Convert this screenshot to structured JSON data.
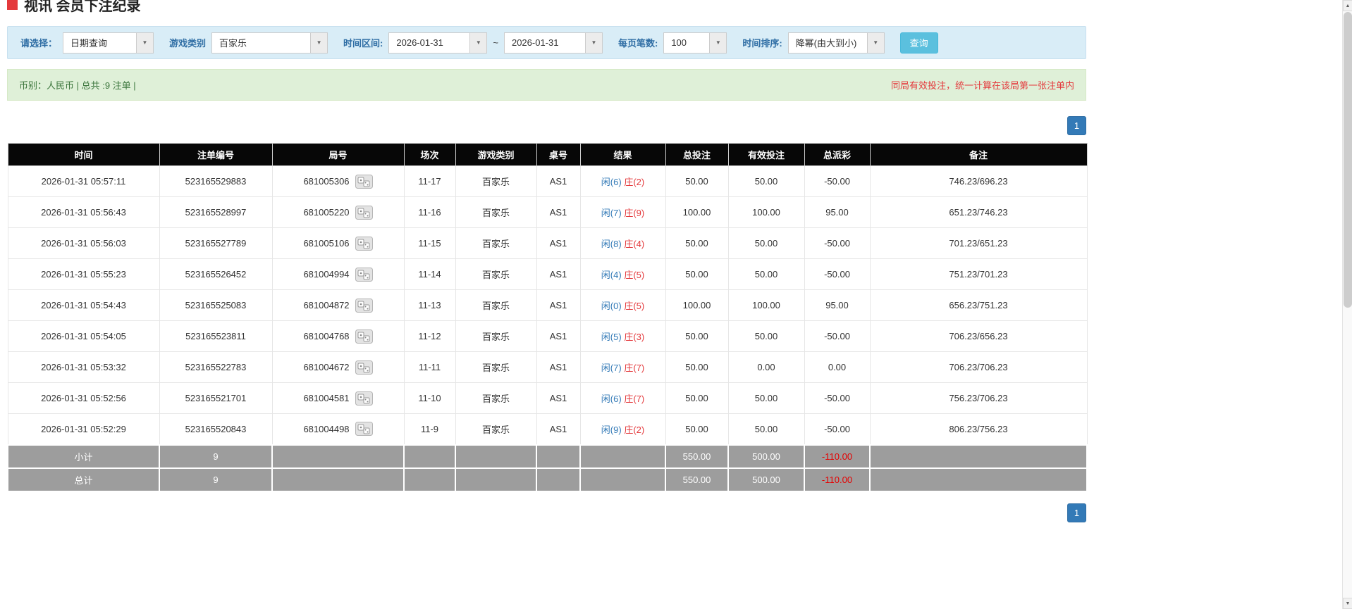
{
  "icons": {
    "title_marker": "red-square",
    "caret": "▼",
    "replay": "round-replay-icon",
    "scroll_up": "▲",
    "scroll_down": "▼"
  },
  "colors": {
    "accent_blue": "#337ab7",
    "negative_red": "#e4393c",
    "filter_bg": "#d9edf7",
    "summary_bg": "#dff0d8",
    "table_header_bg": "#070707",
    "table_footer_bg": "#9d9d9d",
    "query_button_bg": "#5bc0de"
  },
  "page": {
    "title": "视讯 会员下注纪录"
  },
  "filters": {
    "select_label": "请选择：",
    "select_value": "日期查询",
    "game_label": "游戏类别",
    "game_value": "百家乐",
    "range_label": "时间区间:",
    "date_from": "2026-01-31",
    "range_separator": "~",
    "date_to": "2026-01-31",
    "page_size_label": "每页笔数:",
    "page_size_value": "100",
    "sort_label": "时间排序:",
    "sort_value": "降幂(由大到小)",
    "query_button": "查询"
  },
  "summary": {
    "left": "币别：人民币 | 总共 :9 注单 |",
    "right": "同局有效投注，统一计算在该局第一张注单内"
  },
  "pagination": {
    "page": "1"
  },
  "table": {
    "headers": [
      "时间",
      "注单编号",
      "局号",
      "场次",
      "游戏类别",
      "桌号",
      "结果",
      "总投注",
      "有效投注",
      "总派彩",
      "备注"
    ],
    "rows": [
      {
        "time": "2026-01-31 05:57:11",
        "bet_no": "523165529883",
        "round_no": "681005306",
        "session": "11-17",
        "game": "百家乐",
        "table_no": "AS1",
        "result_player": "闲(6)",
        "result_banker": "庄(2)",
        "total_bet": "50.00",
        "valid_bet": "50.00",
        "payout": "-50.00",
        "remark": "746.23/696.23"
      },
      {
        "time": "2026-01-31 05:56:43",
        "bet_no": "523165528997",
        "round_no": "681005220",
        "session": "11-16",
        "game": "百家乐",
        "table_no": "AS1",
        "result_player": "闲(7)",
        "result_banker": "庄(9)",
        "total_bet": "100.00",
        "valid_bet": "100.00",
        "payout": "95.00",
        "remark": "651.23/746.23"
      },
      {
        "time": "2026-01-31 05:56:03",
        "bet_no": "523165527789",
        "round_no": "681005106",
        "session": "11-15",
        "game": "百家乐",
        "table_no": "AS1",
        "result_player": "闲(8)",
        "result_banker": "庄(4)",
        "total_bet": "50.00",
        "valid_bet": "50.00",
        "payout": "-50.00",
        "remark": "701.23/651.23"
      },
      {
        "time": "2026-01-31 05:55:23",
        "bet_no": "523165526452",
        "round_no": "681004994",
        "session": "11-14",
        "game": "百家乐",
        "table_no": "AS1",
        "result_player": "闲(4)",
        "result_banker": "庄(5)",
        "total_bet": "50.00",
        "valid_bet": "50.00",
        "payout": "-50.00",
        "remark": "751.23/701.23"
      },
      {
        "time": "2026-01-31 05:54:43",
        "bet_no": "523165525083",
        "round_no": "681004872",
        "session": "11-13",
        "game": "百家乐",
        "table_no": "AS1",
        "result_player": "闲(0)",
        "result_banker": "庄(5)",
        "total_bet": "100.00",
        "valid_bet": "100.00",
        "payout": "95.00",
        "remark": "656.23/751.23"
      },
      {
        "time": "2026-01-31 05:54:05",
        "bet_no": "523165523811",
        "round_no": "681004768",
        "session": "11-12",
        "game": "百家乐",
        "table_no": "AS1",
        "result_player": "闲(5)",
        "result_banker": "庄(3)",
        "total_bet": "50.00",
        "valid_bet": "50.00",
        "payout": "-50.00",
        "remark": "706.23/656.23"
      },
      {
        "time": "2026-01-31 05:53:32",
        "bet_no": "523165522783",
        "round_no": "681004672",
        "session": "11-11",
        "game": "百家乐",
        "table_no": "AS1",
        "result_player": "闲(7)",
        "result_banker": "庄(7)",
        "total_bet": "50.00",
        "valid_bet": "0.00",
        "payout": "0.00",
        "remark": "706.23/706.23"
      },
      {
        "time": "2026-01-31 05:52:56",
        "bet_no": "523165521701",
        "round_no": "681004581",
        "session": "11-10",
        "game": "百家乐",
        "table_no": "AS1",
        "result_player": "闲(6)",
        "result_banker": "庄(7)",
        "total_bet": "50.00",
        "valid_bet": "50.00",
        "payout": "-50.00",
        "remark": "756.23/706.23"
      },
      {
        "time": "2026-01-31 05:52:29",
        "bet_no": "523165520843",
        "round_no": "681004498",
        "session": "11-9",
        "game": "百家乐",
        "table_no": "AS1",
        "result_player": "闲(9)",
        "result_banker": "庄(2)",
        "total_bet": "50.00",
        "valid_bet": "50.00",
        "payout": "-50.00",
        "remark": "806.23/756.23"
      }
    ],
    "subtotal": {
      "label": "小计",
      "count": "9",
      "total_bet": "550.00",
      "valid_bet": "500.00",
      "payout": "-110.00"
    },
    "total": {
      "label": "总计",
      "count": "9",
      "total_bet": "550.00",
      "valid_bet": "500.00",
      "payout": "-110.00"
    }
  }
}
